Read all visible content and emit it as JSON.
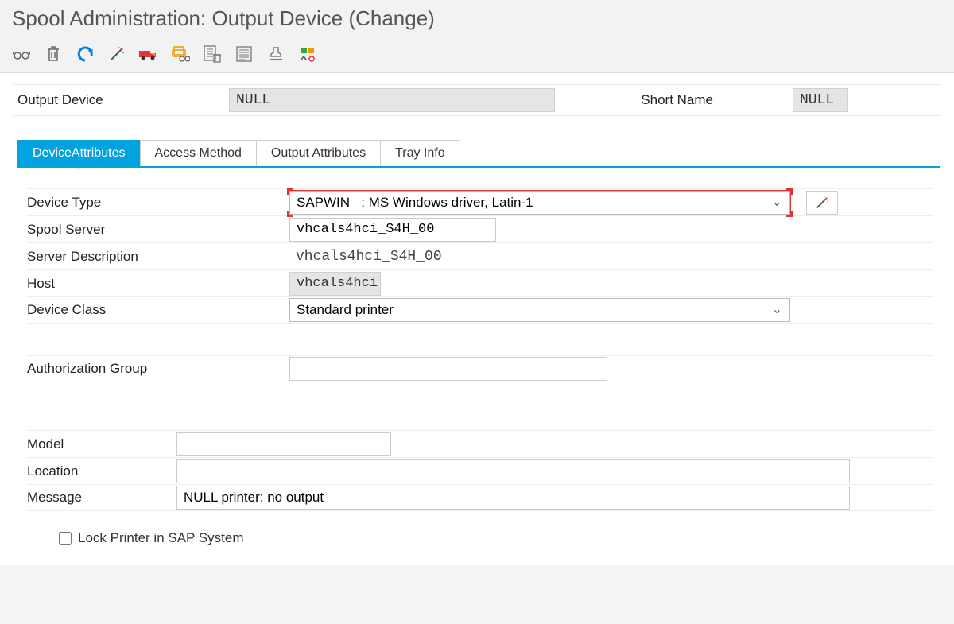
{
  "header": {
    "title": "Spool Administration: Output Device (Change)"
  },
  "toolbar_icons": {
    "glasses": "glasses-icon",
    "trash": "trash-icon",
    "undo": "undo-icon",
    "wand": "wand-icon",
    "truck": "truck-icon",
    "printer_glasses": "printer-glasses-icon",
    "list_trash": "list-trash-icon",
    "report": "report-icon",
    "stamp": "stamp-icon",
    "symbol": "symbol-icon"
  },
  "form": {
    "output_device_label": "Output Device",
    "output_device_value": "NULL",
    "short_name_label": "Short Name",
    "short_name_value": "NULL"
  },
  "tabs": [
    {
      "label": "DeviceAttributes",
      "active": true
    },
    {
      "label": "Access Method",
      "active": false
    },
    {
      "label": "Output Attributes",
      "active": false
    },
    {
      "label": "Tray Info",
      "active": false
    }
  ],
  "attrs": {
    "device_type_label": "Device Type",
    "device_type_value": "SAPWIN   : MS Windows driver, Latin-1",
    "spool_server_label": "Spool Server",
    "spool_server_value": "vhcals4hci_S4H_00",
    "server_desc_label": "Server Description",
    "server_desc_value": "vhcals4hci_S4H_00",
    "host_label": "Host",
    "host_value": "vhcals4hci",
    "device_class_label": "Device Class",
    "device_class_value": "Standard printer",
    "auth_group_label": "Authorization Group",
    "auth_group_value": ""
  },
  "info": {
    "model_label": "Model",
    "model_value": "",
    "location_label": "Location",
    "location_value": "",
    "message_label": "Message",
    "message_value": "NULL printer: no output"
  },
  "lock": {
    "label": "Lock Printer in SAP System",
    "checked": false
  }
}
